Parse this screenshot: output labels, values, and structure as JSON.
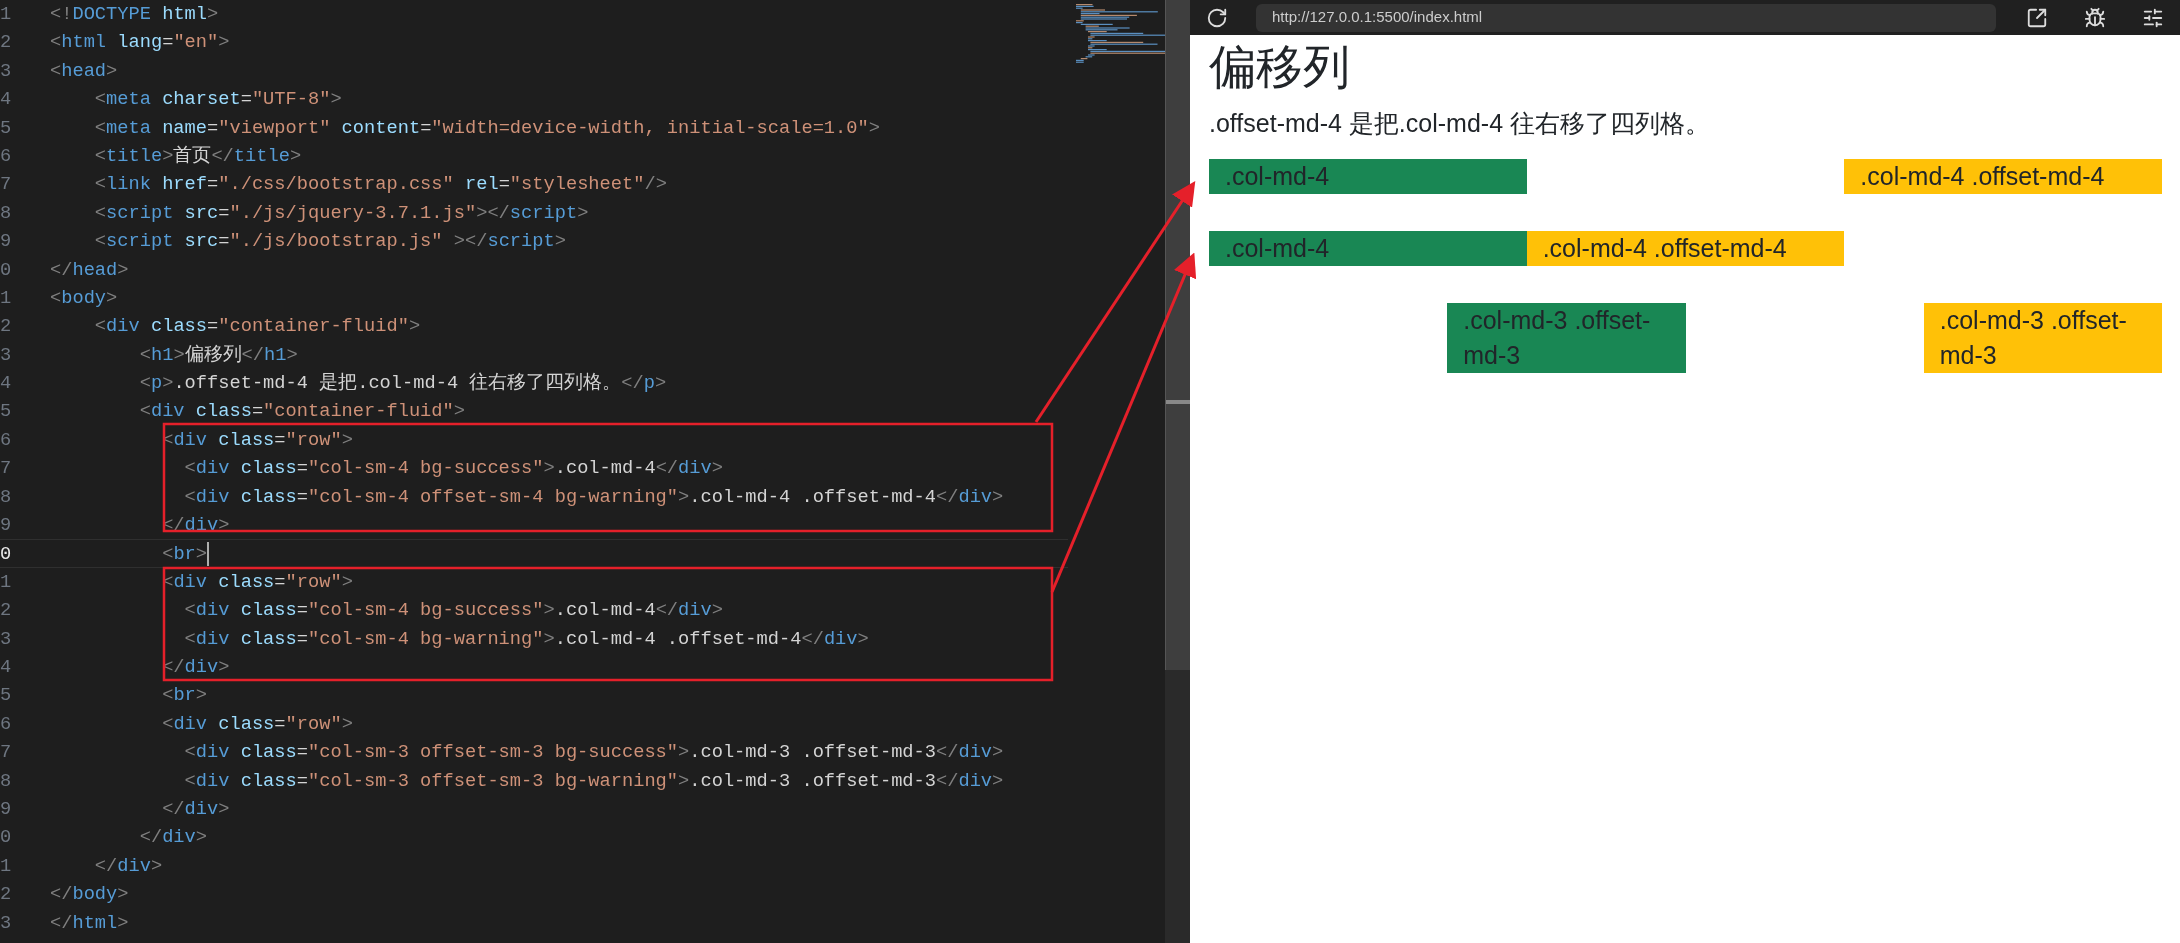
{
  "editor": {
    "lines": [
      {
        "number": "1",
        "text": "<!DOCTYPE html>",
        "current": false
      },
      {
        "number": "2",
        "text": "<html lang=\"en\">",
        "current": false
      },
      {
        "number": "3",
        "text": "<head>",
        "current": false
      },
      {
        "number": "4",
        "text": "    <meta charset=\"UTF-8\">",
        "current": false
      },
      {
        "number": "5",
        "text": "    <meta name=\"viewport\" content=\"width=device-width, initial-scale=1.0\">",
        "current": false
      },
      {
        "number": "6",
        "text": "    <title>首页</title>",
        "current": false
      },
      {
        "number": "7",
        "text": "    <link href=\"./css/bootstrap.css\" rel=\"stylesheet\"/>",
        "current": false
      },
      {
        "number": "8",
        "text": "    <script src=\"./js/jquery-3.7.1.js\"></script>",
        "current": false
      },
      {
        "number": "9",
        "text": "    <script src=\"./js/bootstrap.js\" ></script>",
        "current": false
      },
      {
        "number": "0",
        "text": "</head>",
        "current": false
      },
      {
        "number": "1",
        "text": "<body>",
        "current": false
      },
      {
        "number": "2",
        "text": "    <div class=\"container-fluid\">",
        "current": false
      },
      {
        "number": "3",
        "text": "        <h1>偏移列</h1>",
        "current": false
      },
      {
        "number": "4",
        "text": "        <p>.offset-md-4 是把.col-md-4 往右移了四列格。</p>",
        "current": false
      },
      {
        "number": "5",
        "text": "        <div class=\"container-fluid\">",
        "current": false
      },
      {
        "number": "6",
        "text": "          <div class=\"row\">",
        "current": false
      },
      {
        "number": "7",
        "text": "            <div class=\"col-sm-4 bg-success\">.col-md-4</div>",
        "current": false
      },
      {
        "number": "8",
        "text": "            <div class=\"col-sm-4 offset-sm-4 bg-warning\">.col-md-4 .offset-md-4</div>",
        "current": false
      },
      {
        "number": "9",
        "text": "          </div>",
        "current": false
      },
      {
        "number": "0",
        "text": "          <br>",
        "current": true
      },
      {
        "number": "1",
        "text": "          <div class=\"row\">",
        "current": false
      },
      {
        "number": "2",
        "text": "            <div class=\"col-sm-4 bg-success\">.col-md-4</div>",
        "current": false
      },
      {
        "number": "3",
        "text": "            <div class=\"col-sm-4 bg-warning\">.col-md-4 .offset-md-4</div>",
        "current": false
      },
      {
        "number": "4",
        "text": "          </div>",
        "current": false
      },
      {
        "number": "5",
        "text": "          <br>",
        "current": false
      },
      {
        "number": "6",
        "text": "          <div class=\"row\">",
        "current": false
      },
      {
        "number": "7",
        "text": "            <div class=\"col-sm-3 offset-sm-3 bg-success\">.col-md-3 .offset-md-3</div>",
        "current": false
      },
      {
        "number": "8",
        "text": "            <div class=\"col-sm-3 offset-sm-3 bg-warning\">.col-md-3 .offset-md-3</div>",
        "current": false
      },
      {
        "number": "9",
        "text": "          </div>",
        "current": false
      },
      {
        "number": "0",
        "text": "        </div>",
        "current": false
      },
      {
        "number": "1",
        "text": "    </div>",
        "current": false
      },
      {
        "number": "2",
        "text": "</body>",
        "current": false
      },
      {
        "number": "3",
        "text": "</html>",
        "current": false
      }
    ]
  },
  "browser": {
    "url": "http://127.0.0.1:5500/index.html",
    "page": {
      "heading": "偏移列",
      "paragraph": ".offset-md-4 是把.col-md-4 往右移了四列格。",
      "rows": [
        {
          "cells": [
            {
              "text": ".col-md-4",
              "kind": "success"
            },
            {
              "text": ".col-md-4 .offset-md-4",
              "kind": "warning"
            }
          ]
        },
        {
          "cells": [
            {
              "text": ".col-md-4",
              "kind": "success"
            },
            {
              "text": ".col-md-4 .offset-md-4",
              "kind": "warning"
            }
          ]
        },
        {
          "cells": [
            {
              "text": ".col-md-3 .offset-md-3",
              "kind": "success"
            },
            {
              "text": ".col-md-3 .offset-md-3",
              "kind": "warning"
            }
          ]
        }
      ]
    }
  }
}
